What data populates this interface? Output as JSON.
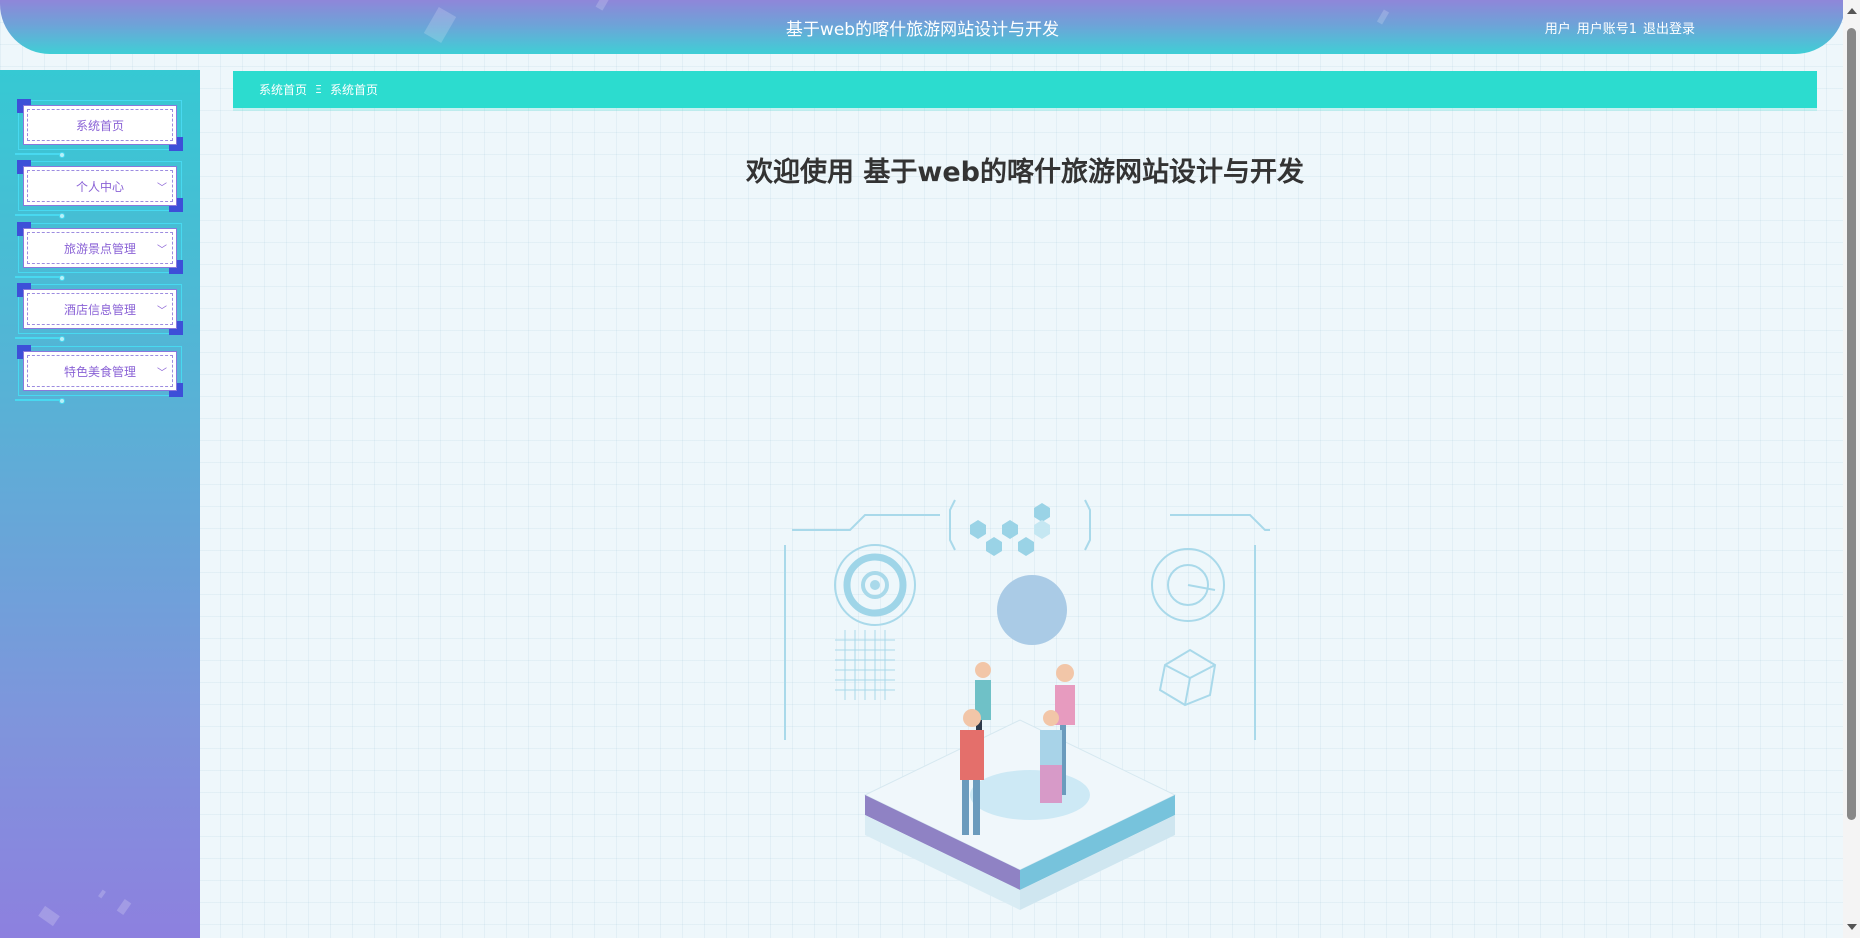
{
  "header": {
    "title": "基于web的喀什旅游网站设计与开发",
    "role": "用户",
    "username": "用户账号1",
    "logout_label": "退出登录"
  },
  "sidebar": {
    "items": [
      {
        "label": "系统首页",
        "has_submenu": false
      },
      {
        "label": "个人中心",
        "has_submenu": true
      },
      {
        "label": "旅游景点管理",
        "has_submenu": true
      },
      {
        "label": "酒店信息管理",
        "has_submenu": true
      },
      {
        "label": "特色美食管理",
        "has_submenu": true
      }
    ]
  },
  "breadcrumb": {
    "items": [
      "系统首页",
      "系统首页"
    ],
    "separator": "Ξ"
  },
  "main": {
    "welcome": "欢迎使用 基于web的喀什旅游网站设计与开发"
  },
  "colors": {
    "breadcrumb_bg": "#2cdccf",
    "menu_text": "#8a62d6",
    "accent_blue": "#3d4fd8"
  }
}
